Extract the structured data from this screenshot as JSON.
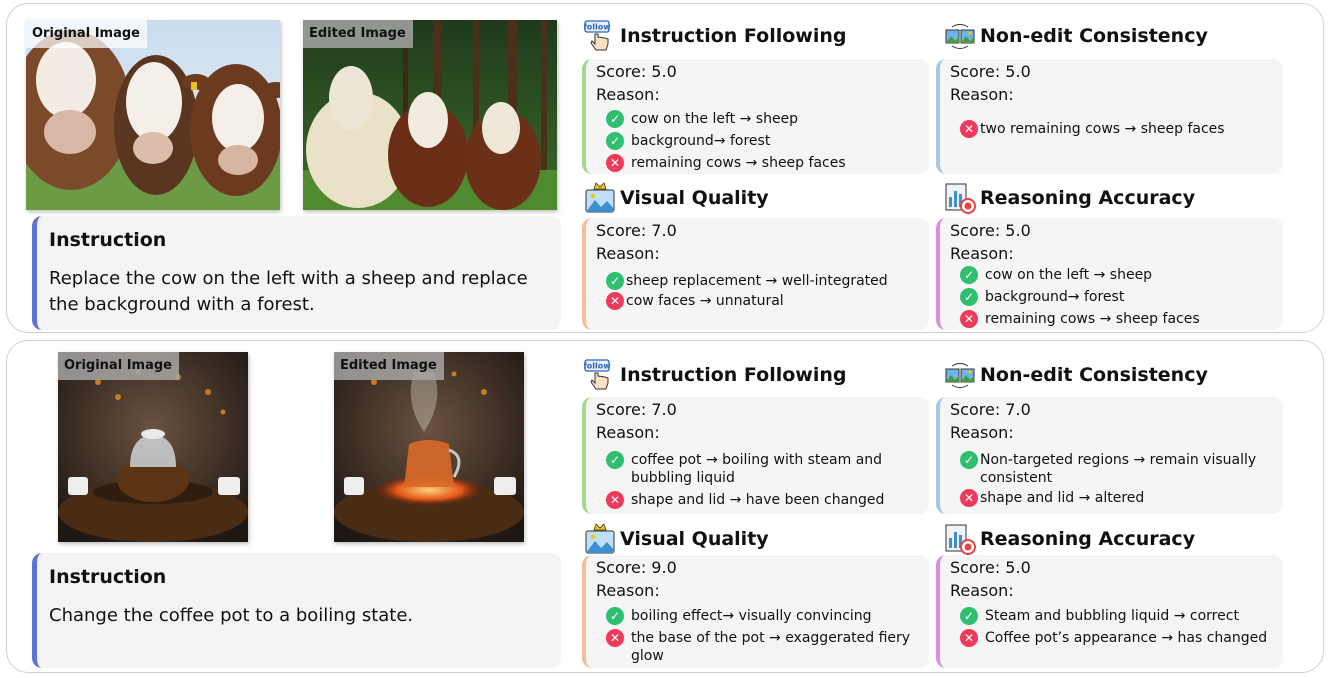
{
  "labels": {
    "original": "Original Image",
    "edited": "Edited Image",
    "instruction": "Instruction",
    "reason": "Reason:",
    "score_prefix": "Score: ",
    "follow_badge": "follow"
  },
  "criteria": {
    "instruction_following": "Instruction Following",
    "non_edit_consistency": "Non-edit Consistency",
    "visual_quality": "Visual Quality",
    "reasoning_accuracy": "Reasoning Accuracy"
  },
  "colors": {
    "instruction_accent": "#5f73d6",
    "instruction_following_accent": "#a8d68e",
    "non_edit_consistency_accent": "#a9c6e6",
    "visual_quality_accent": "#f0c09c",
    "reasoning_accuracy_accent": "#dc8fd8",
    "check": "#2fbf71",
    "cross": "#ee3a5b"
  },
  "icons": {
    "instruction_following": "follow-hand-icon",
    "non_edit_consistency": "image-compare-icon",
    "visual_quality": "image-crown-icon",
    "reasoning_accuracy": "chart-target-icon",
    "check": "check-circle-icon",
    "cross": "cross-circle-icon"
  },
  "examples": [
    {
      "instruction": "Replace the cow on the left with a sheep and replace the background with a forest.",
      "instruction_following": {
        "score": "5.0",
        "reasons": [
          {
            "ok": true,
            "text": "cow on the left → sheep"
          },
          {
            "ok": true,
            "text": "background→ forest"
          },
          {
            "ok": false,
            "text": "remaining cows → sheep faces"
          }
        ]
      },
      "non_edit_consistency": {
        "score": "5.0",
        "reasons": [
          {
            "ok": false,
            "text": "two remaining cows → sheep faces"
          }
        ]
      },
      "visual_quality": {
        "score": "7.0",
        "reasons": [
          {
            "ok": true,
            "text": "sheep replacement → well-integrated"
          },
          {
            "ok": false,
            "text": "cow faces → unnatural"
          }
        ]
      },
      "reasoning_accuracy": {
        "score": "5.0",
        "reasons": [
          {
            "ok": true,
            "text": "cow on the left → sheep"
          },
          {
            "ok": true,
            "text": "background→ forest"
          },
          {
            "ok": false,
            "text": "remaining cows → sheep faces"
          }
        ]
      }
    },
    {
      "instruction": "Change the coffee pot to a boiling state.",
      "instruction_following": {
        "score": "7.0",
        "reasons": [
          {
            "ok": true,
            "text": "coffee pot → boiling with steam and bubbling liquid"
          },
          {
            "ok": false,
            "text": "shape and lid → have been changed"
          }
        ]
      },
      "non_edit_consistency": {
        "score": "7.0",
        "reasons": [
          {
            "ok": true,
            "text": "Non-targeted regions → remain visually consistent"
          },
          {
            "ok": false,
            "text": "shape and lid → altered"
          }
        ]
      },
      "visual_quality": {
        "score": "9.0",
        "reasons": [
          {
            "ok": true,
            "text": "boiling effect→ visually convincing"
          },
          {
            "ok": false,
            "text": "the base of the pot → exaggerated fiery glow"
          }
        ]
      },
      "reasoning_accuracy": {
        "score": "5.0",
        "reasons": [
          {
            "ok": true,
            "text": "Steam and bubbling liquid → correct"
          },
          {
            "ok": false,
            "text": "Coffee pot’s appearance → has changed"
          }
        ]
      }
    }
  ]
}
